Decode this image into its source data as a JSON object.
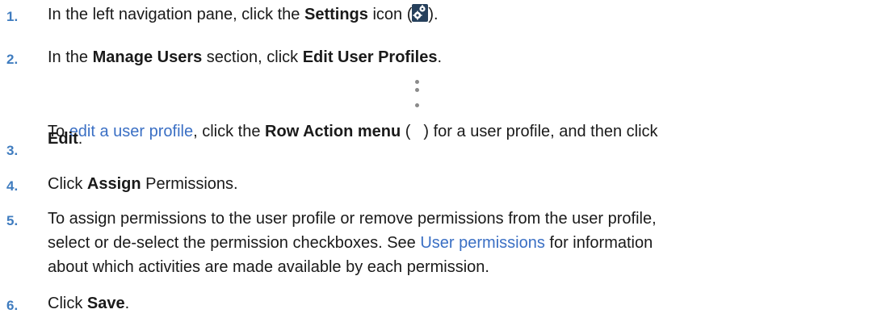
{
  "steps": [
    {
      "number": "1.",
      "parts": {
        "a": "In the left navigation pane, click the ",
        "b": "Settings",
        "c": " icon (",
        "d": ")."
      }
    },
    {
      "number": "2.",
      "parts": {
        "a": "In the ",
        "b": "Manage Users",
        "c": " section, click ",
        "d": "Edit User Profiles",
        "e": "."
      }
    },
    {
      "number": "3.",
      "parts": {
        "a": "To ",
        "link": "edit a user profile",
        "b": ", click the ",
        "c": "Row Action menu",
        "d": " (",
        "e": ") for a user profile, and then click",
        "f": "Edit",
        "g": "."
      }
    },
    {
      "number": "4.",
      "parts": {
        "a": "Click ",
        "b": "Assign",
        "c": " Permissions."
      }
    },
    {
      "number": "5.",
      "parts": {
        "a": "To assign permissions to the user profile or remove permissions from the user profile,",
        "b": "select or de-select the permission checkboxes. See ",
        "link": "User permissions",
        "c": " for information",
        "d": "about which activities are made available by each permission."
      }
    },
    {
      "number": "6.",
      "parts": {
        "a": "Click ",
        "b": "Save",
        "c": "."
      }
    }
  ],
  "icons": {
    "settings": "settings-gear-icon",
    "row_action": "kebab-menu-icon"
  },
  "colors": {
    "number": "#3f7cbf",
    "link": "#3a6fc4",
    "text": "#1a1a1a"
  }
}
